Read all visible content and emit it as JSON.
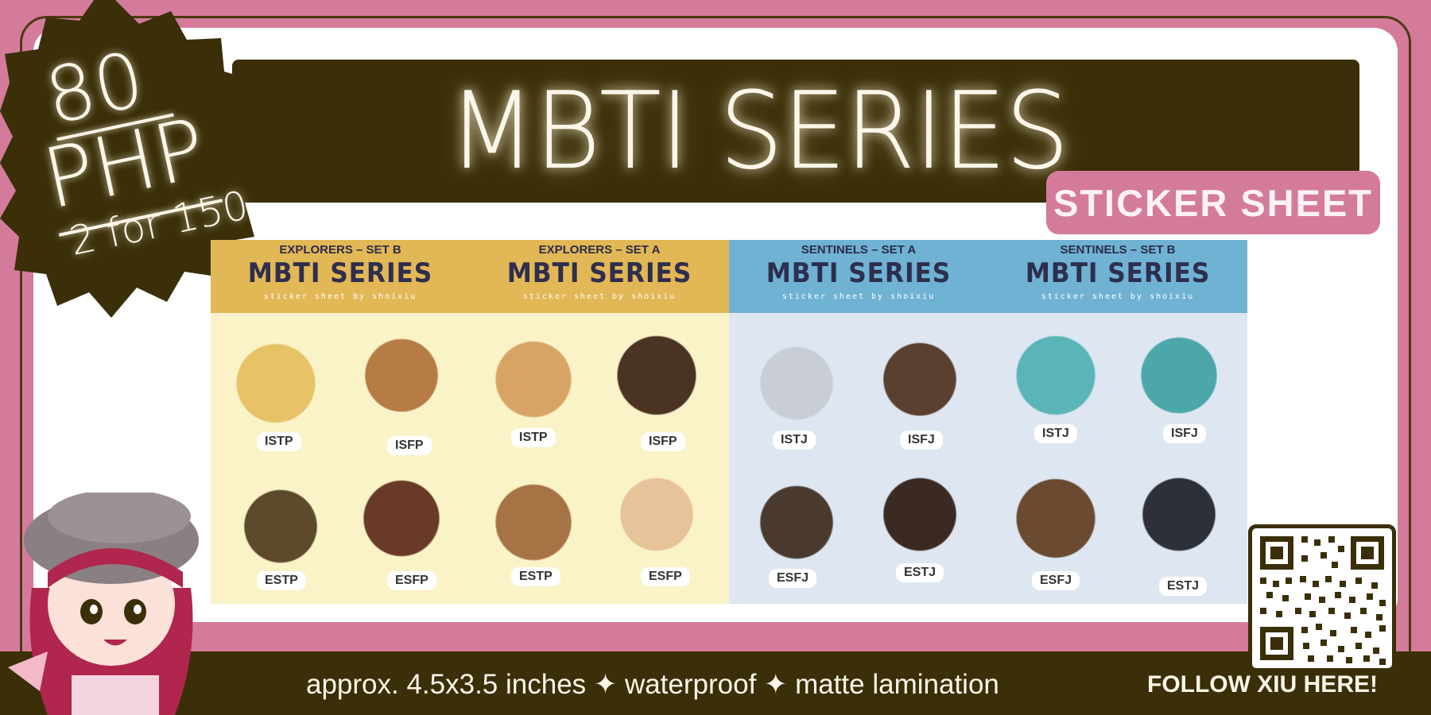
{
  "title": "MBTI SERIES",
  "tag": "STICKER SHEET",
  "price": {
    "amount": "80",
    "currency": "PHP",
    "deal": "2 for 150"
  },
  "specs": "approx. 4.5x3.5 inches ✦ waterproof ✦ matte lamination",
  "follow": "FOLLOW XIU HERE!",
  "sheets": [
    {
      "subtitle": "EXPLORERS – SET B",
      "title": "MBTI SERIES",
      "credit": "sticker sheet by shoixiu",
      "labels": [
        "ISTP",
        "ISFP",
        "ESTP",
        "ESFP"
      ]
    },
    {
      "subtitle": "EXPLORERS – SET A",
      "title": "MBTI SERIES",
      "credit": "sticker sheet by shoixiu",
      "labels": [
        "ISTP",
        "ISFP",
        "ESTP",
        "ESFP"
      ]
    },
    {
      "subtitle": "SENTINELS – SET A",
      "title": "MBTI SERIES",
      "credit": "sticker sheet by shoixiu",
      "labels": [
        "ISTJ",
        "ISFJ",
        "ESFJ",
        "ESTJ"
      ]
    },
    {
      "subtitle": "SENTINELS – SET B",
      "title": "MBTI SERIES",
      "credit": "sticker sheet by shoixiu",
      "labels": [
        "ISTJ",
        "ISFJ",
        "ESFJ",
        "ESTJ"
      ]
    }
  ],
  "colors": {
    "pink": "#d47b9b",
    "dark": "#3a2f08",
    "glow": "#fbf6e9",
    "explorer_head": "#e2b755",
    "explorer_body": "#fbf3c8",
    "sentinel_head": "#6fb2d4",
    "sentinel_body": "#dde6f1"
  },
  "icons": {
    "qr": "qr-code-icon",
    "avatar": "chibi-avatar-illustration"
  }
}
